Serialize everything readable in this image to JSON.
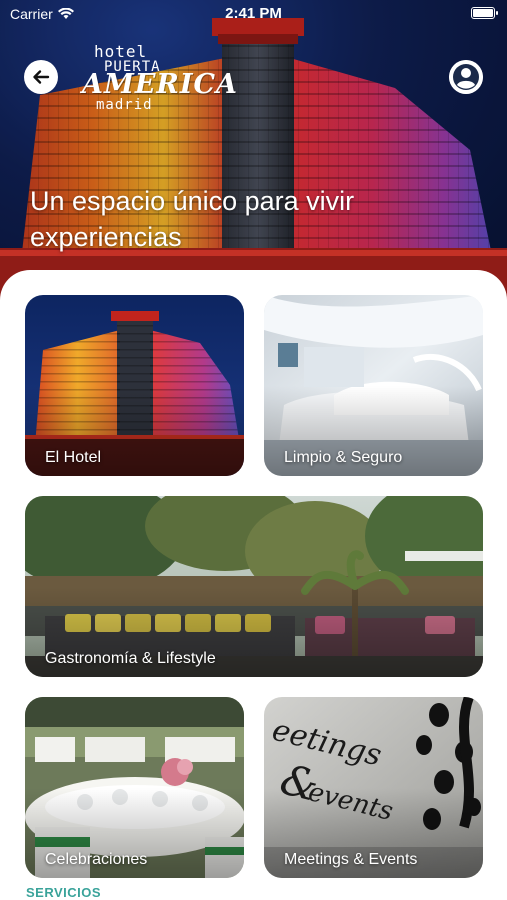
{
  "status_bar": {
    "carrier": "Carrier",
    "time": "2:41 PM"
  },
  "header": {
    "logo": {
      "line1": "hotel",
      "line2": "PUERTA",
      "line3": "AMERICA",
      "line4": "madrid"
    },
    "title": "Un espacio único para vivir experiencias",
    "icons": {
      "back": "arrow-left-icon",
      "profile": "user-icon"
    }
  },
  "cards": [
    {
      "label": "El Hotel"
    },
    {
      "label": "Limpio & Seguro"
    },
    {
      "label": "Gastronomía & Lifestyle"
    },
    {
      "label": "Celebraciones"
    },
    {
      "label": "Meetings & Events"
    }
  ],
  "sections": {
    "services": "SERVICIOS"
  },
  "colors": {
    "accent": "#3aa39a",
    "sheet": "#ffffff"
  }
}
